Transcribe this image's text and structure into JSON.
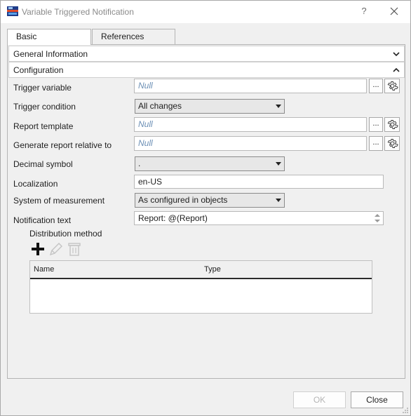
{
  "window": {
    "title": "Variable Triggered Notification",
    "help_label": "?"
  },
  "tabs": [
    {
      "label": "Basic",
      "active": true
    },
    {
      "label": "References",
      "active": false
    }
  ],
  "sections": {
    "general": {
      "label": "General Information",
      "expanded": false
    },
    "configuration": {
      "label": "Configuration",
      "expanded": true
    }
  },
  "form": {
    "trigger_variable": {
      "label": "Trigger variable",
      "value": "Null"
    },
    "trigger_condition": {
      "label": "Trigger condition",
      "value": "All changes"
    },
    "report_template": {
      "label": "Report template",
      "value": "Null"
    },
    "generate_relative": {
      "label": "Generate report relative to",
      "value": "Null"
    },
    "decimal_symbol": {
      "label": "Decimal symbol",
      "value": "."
    },
    "localization": {
      "label": "Localization",
      "value": "en-US"
    },
    "measurement": {
      "label": "System of measurement",
      "value": "As configured in objects"
    },
    "notification_text": {
      "label": "Notification text",
      "value": "Report: @(Report)"
    },
    "browse_label": "..."
  },
  "distribution": {
    "label": "Distribution method",
    "columns": [
      "Name",
      "Type"
    ],
    "rows": []
  },
  "buttons": {
    "ok": "OK",
    "close": "Close"
  },
  "colors": {
    "null_text": "#6b8fb5",
    "grid_header_rule": "#2b2b2b"
  }
}
